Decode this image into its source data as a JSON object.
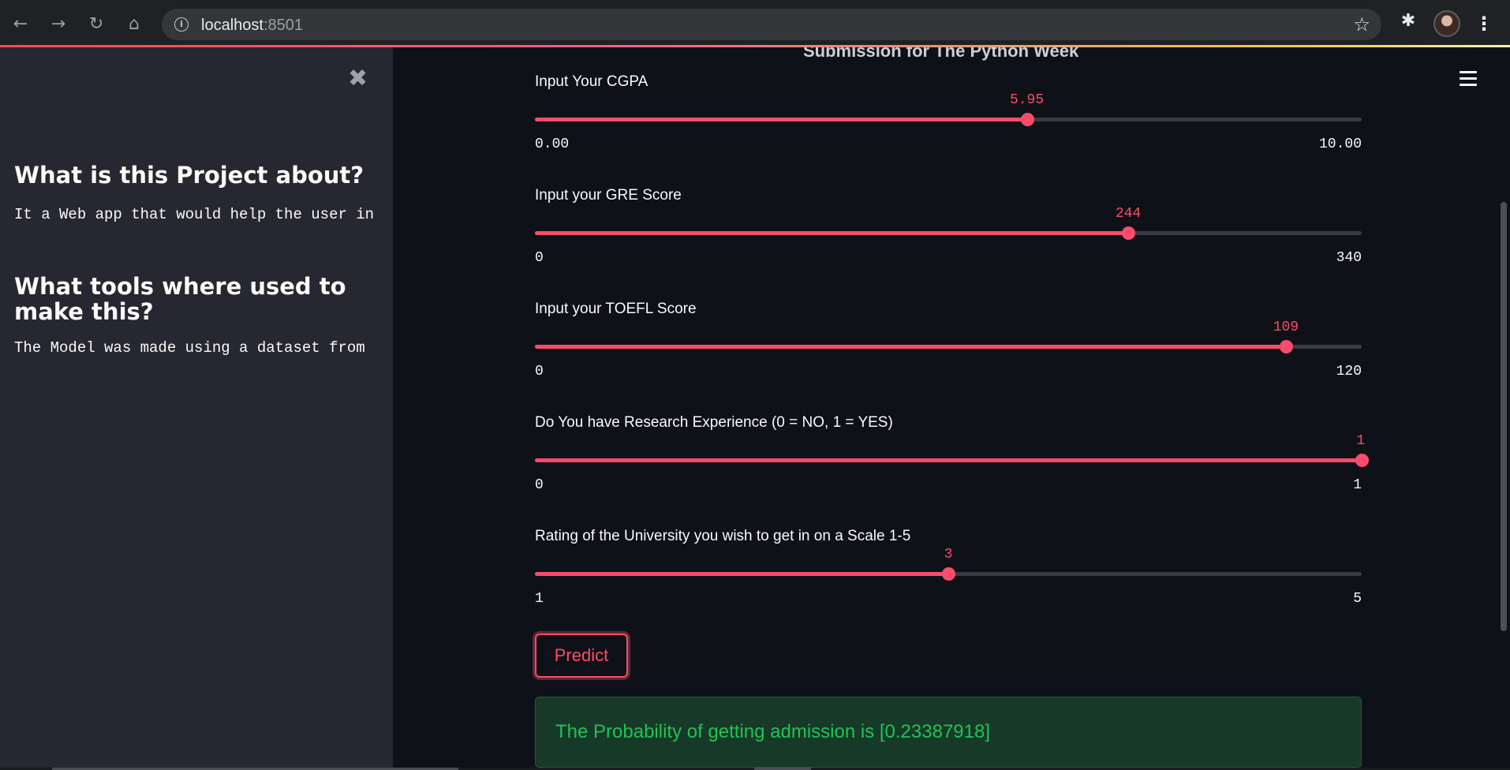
{
  "browser": {
    "url_host": "localhost",
    "url_port": ":8501",
    "icons": [
      "back-arrow-icon",
      "forward-arrow-icon",
      "reload-icon",
      "home-icon",
      "info-icon",
      "star-icon",
      "extensions-icon",
      "kebab-menu-icon"
    ]
  },
  "sidebar": {
    "close_glyph": "✖",
    "sections": [
      {
        "heading": "What is this Project about?",
        "text": "It a Web app that would help the user in"
      },
      {
        "heading": "What tools where used to make this?",
        "text": "The Model was made using a dataset from"
      }
    ]
  },
  "main": {
    "title": "Submission for The Python Week",
    "accent_color": "#ff4b6b",
    "sliders": [
      {
        "label": "Input Your CGPA",
        "value": "5.95",
        "min": "0.00",
        "max": "10.00",
        "fraction": 0.595
      },
      {
        "label": "Input your GRE Score",
        "value": "244",
        "min": "0",
        "max": "340",
        "fraction": 0.7176
      },
      {
        "label": "Input your TOEFL Score",
        "value": "109",
        "min": "0",
        "max": "120",
        "fraction": 0.9083
      },
      {
        "label": "Do You have Research Experience (0 = NO, 1 = YES)",
        "value": "1",
        "min": "0",
        "max": "1",
        "fraction": 1.0
      },
      {
        "label": "Rating of the University you wish to get in on a Scale 1-5",
        "value": "3",
        "min": "1",
        "max": "5",
        "fraction": 0.5
      }
    ],
    "predict_label": "Predict",
    "result": "The Probability of getting admission is [0.23387918]"
  }
}
